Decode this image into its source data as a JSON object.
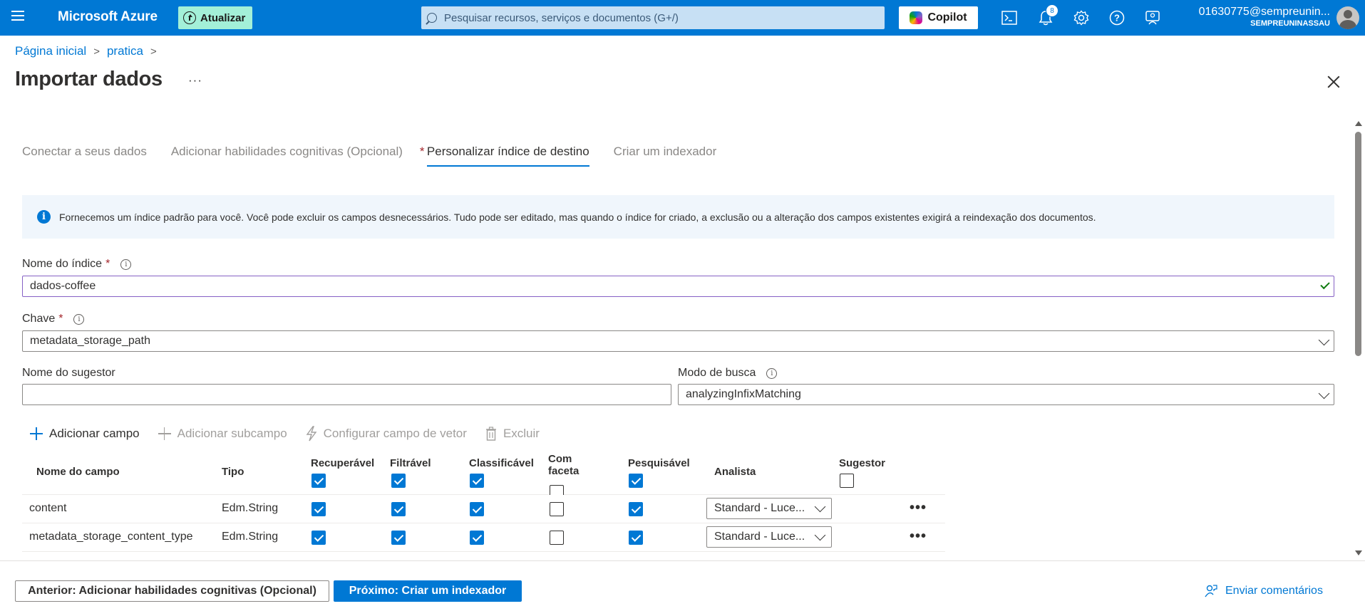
{
  "topbar": {
    "brand": "Microsoft Azure",
    "update_label": "Atualizar",
    "search_placeholder": "Pesquisar recursos, serviços e documentos (G+/)",
    "copilot_label": "Copilot",
    "notifications_count": "8",
    "account_email": "01630775@sempreunin...",
    "account_org": "SEMPREUNINASSAU"
  },
  "breadcrumb": {
    "home": "Página inicial",
    "item": "pratica"
  },
  "page": {
    "title": "Importar dados",
    "more": "···"
  },
  "tabs": [
    {
      "label": "Conectar a seus dados"
    },
    {
      "label": "Adicionar habilidades cognitivas (Opcional)"
    },
    {
      "label": "Personalizar índice de destino",
      "required_mark": "*"
    },
    {
      "label": "Criar um indexador"
    }
  ],
  "info": {
    "text": "Fornecemos um índice padrão para você. Você pode excluir os campos desnecessários. Tudo pode ser editado, mas quando o índice for criado, a exclusão ou a alteração dos campos existentes exigirá a reindexação dos documentos."
  },
  "form": {
    "index_name_label": "Nome do índice",
    "index_name_value": "dados-coffee",
    "key_label": "Chave",
    "key_value": "metadata_storage_path",
    "suggester_label": "Nome do sugestor",
    "suggester_value": "",
    "search_mode_label": "Modo de busca",
    "search_mode_value": "analyzingInfixMatching",
    "required_mark": "*"
  },
  "commands": {
    "add_field": "Adicionar campo",
    "add_subfield": "Adicionar subcampo",
    "configure_vector": "Configurar campo de vetor",
    "delete": "Excluir"
  },
  "table": {
    "headers": {
      "name": "Nome do campo",
      "type": "Tipo",
      "retrievable": "Recuperável",
      "filterable": "Filtrável",
      "sortable": "Classificável",
      "facetable": "Com faceta",
      "searchable": "Pesquisável",
      "analyzer": "Analista",
      "suggester": "Sugestor"
    },
    "header_checks": {
      "retrievable": true,
      "filterable": true,
      "sortable": true,
      "facetable": false,
      "searchable": true,
      "suggester": false
    },
    "rows": [
      {
        "name": "content",
        "type": "Edm.String",
        "retrievable": true,
        "filterable": true,
        "sortable": true,
        "facetable": false,
        "searchable": true,
        "analyzer": "Standard - Luce..."
      },
      {
        "name": "metadata_storage_content_type",
        "type": "Edm.String",
        "retrievable": true,
        "filterable": true,
        "sortable": true,
        "facetable": false,
        "searchable": true,
        "analyzer": "Standard - Luce..."
      }
    ]
  },
  "footer": {
    "prev_label": "Anterior: Adicionar habilidades cognitivas (Opcional)",
    "next_label": "Próximo: Criar um indexador",
    "feedback_label": "Enviar comentários"
  },
  "colors": {
    "azure_blue": "#0078d4",
    "update_green": "#a3f0d8",
    "required_red": "#a4262c",
    "focus_purple": "#8661c5"
  }
}
